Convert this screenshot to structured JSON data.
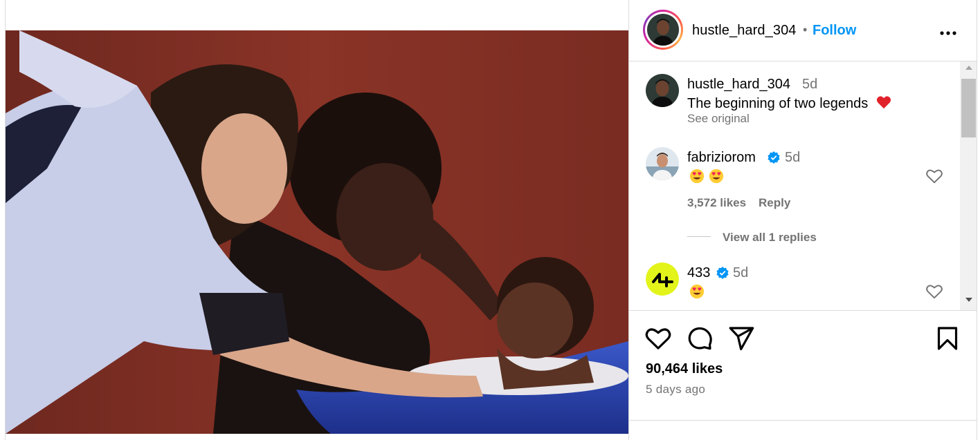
{
  "post": {
    "username": "hustle_hard_304",
    "separator": "•",
    "follow_label": "Follow",
    "more_label": "•••"
  },
  "caption": {
    "username": "hustle_hard_304",
    "time": "5d",
    "text": "The beginning of two legends",
    "see_original": "See original"
  },
  "comments": [
    {
      "username": "fabriziorom",
      "verified": true,
      "time": "5d",
      "emoji_count": 2,
      "likes": "3,572 likes",
      "reply_label": "Reply",
      "view_replies": "View all 1 replies"
    },
    {
      "username": "433",
      "verified": true,
      "time": "5d",
      "emoji_count": 1
    }
  ],
  "actions": {
    "likes": "90,464 likes",
    "time_ago": "5 days ago"
  },
  "icons": {
    "like": "heart-icon",
    "comment": "comment-icon",
    "share": "send-icon",
    "save": "bookmark-icon",
    "more": "more-horizontal-icon",
    "verified": "verified-badge-icon",
    "caption_heart": "red-heart-emoji",
    "emoji": "heart-eyes-emoji"
  },
  "colors": {
    "follow": "#0095f6",
    "verified": "#0095f6",
    "secondary_text": "#737373",
    "border": "#dbdbdb"
  }
}
